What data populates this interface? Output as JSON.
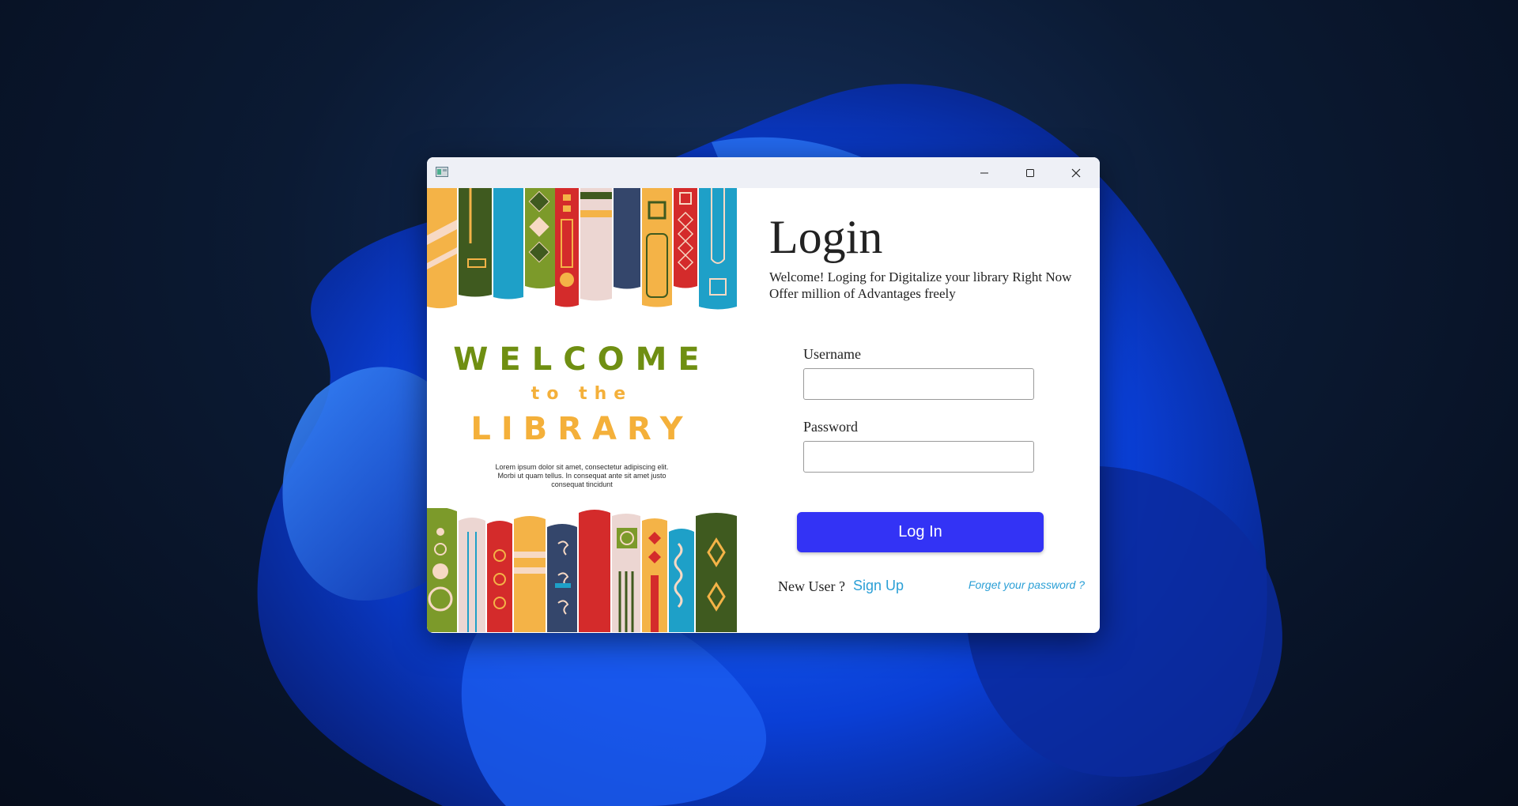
{
  "window": {
    "minimize_label": "minimize",
    "maximize_label": "maximize",
    "close_label": "close"
  },
  "poster": {
    "welcome": "WELCOME",
    "to_the": "to the",
    "library": "LIBRARY",
    "lorem": "Lorem ipsum dolor sit amet, consectetur adipiscing elit. Morbi ut quam tellus. In consequat ante sit amet justo consequat tincidunt"
  },
  "login": {
    "title": "Login",
    "subtitle_line1": "Welcome! Loging for Digitalize your library Right Now",
    "subtitle_line2": "Offer million of Advantages freely",
    "username_label": "Username",
    "username_value": "",
    "password_label": "Password",
    "password_value": "",
    "login_button": "Log In",
    "new_user_label": "New User ?",
    "signup_link": "Sign Up",
    "forgot_link": "Forget your password ?"
  },
  "colors": {
    "accent": "#3333f5",
    "link": "#2a9fd6",
    "welcome_green": "#6f8f12",
    "library_orange": "#f4b03a"
  },
  "icons": {
    "app": "app-window-icon",
    "minimize": "minimize-icon",
    "maximize": "maximize-icon",
    "close": "close-icon"
  }
}
